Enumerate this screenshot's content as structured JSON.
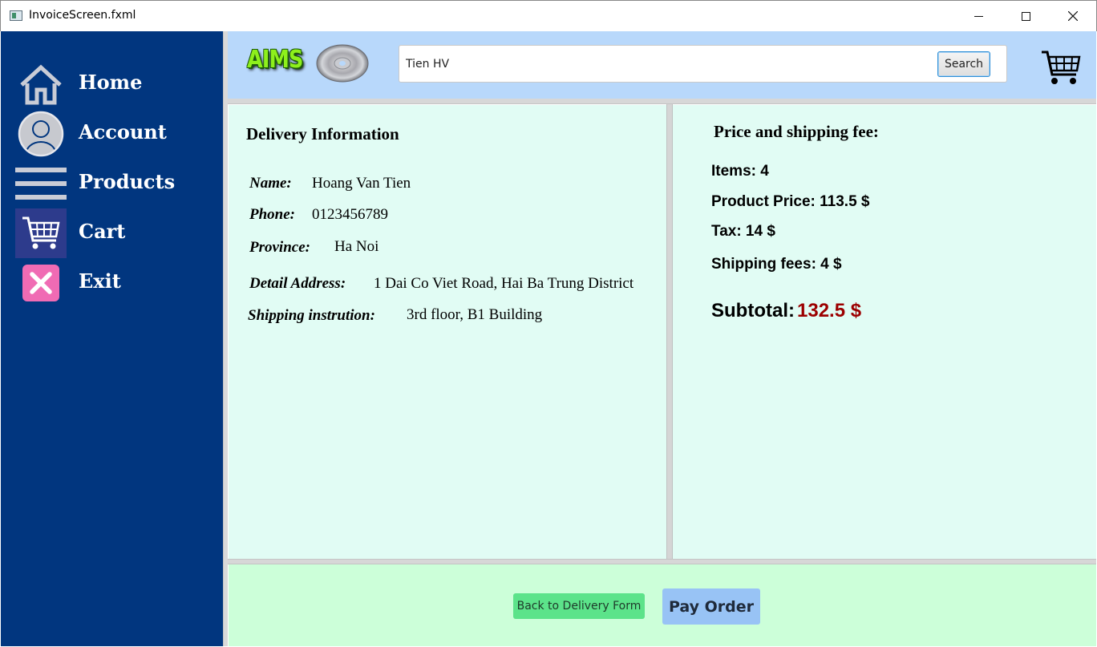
{
  "window": {
    "title": "InvoiceScreen.fxml"
  },
  "sidebar": {
    "items": [
      {
        "label": "Home",
        "icon": "home-icon"
      },
      {
        "label": "Account",
        "icon": "account-icon"
      },
      {
        "label": "Products",
        "icon": "menu-icon"
      },
      {
        "label": "Cart",
        "icon": "cart-icon",
        "active": true
      },
      {
        "label": "Exit",
        "icon": "close-icon"
      }
    ]
  },
  "header": {
    "logo_text": "AIMS",
    "search": {
      "value": "Tien HV",
      "button_label": "Search"
    }
  },
  "delivery": {
    "title": "Delivery Information",
    "fields": [
      {
        "label": "Name:",
        "value": "Hoang Van Tien"
      },
      {
        "label": "Phone:",
        "value": "0123456789"
      },
      {
        "label": "Province:",
        "value": "Ha Noi"
      },
      {
        "label": "Detail Address:",
        "value": "1 Dai Co Viet Road, Hai Ba Trung District"
      },
      {
        "label": "Shipping instrution:",
        "value": "3rd floor, B1 Building"
      }
    ]
  },
  "price": {
    "title": "Price and shipping fee:",
    "items": "Items: 4",
    "product_price": "Product Price: 113.5 $",
    "tax": "Tax: 14 $",
    "shipping": "Shipping fees: 4 $",
    "subtotal_label": "Subtotal:",
    "subtotal_value": "132.5 $"
  },
  "footer": {
    "back_label": "Back to Delivery Form",
    "pay_label": "Pay Order"
  },
  "colors": {
    "sidebar_bg": "#01367f",
    "header_bg": "#b8d8fb",
    "panel_bg": "#e1fcf4",
    "footer_bg": "#ccffd9",
    "subtotal": "#9c0000",
    "back_button": "#5ce38a",
    "pay_button": "#98c3f5"
  }
}
